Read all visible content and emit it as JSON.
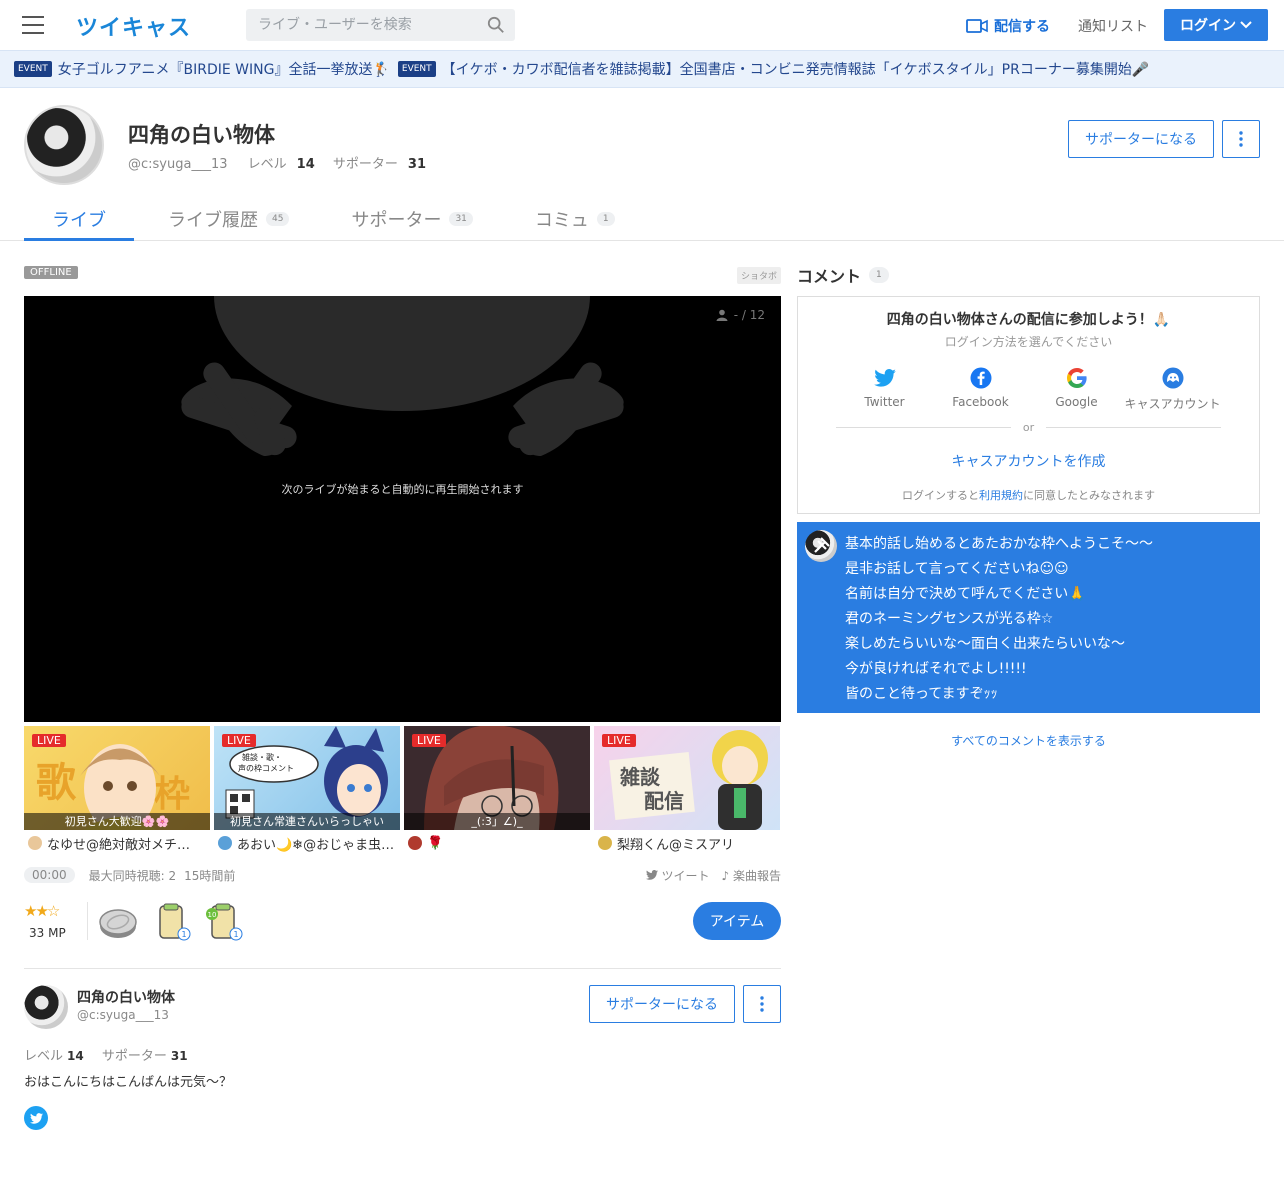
{
  "header": {
    "logo": "ツイキャス",
    "search_placeholder": "ライブ・ユーザーを検索",
    "broadcast_label": "配信する",
    "notify_label": "通知リスト",
    "login_label": "ログイン"
  },
  "events": [
    {
      "badge": "EVENT",
      "text": "女子ゴルフアニメ『BIRDIE WING』全話一挙放送🏌"
    },
    {
      "badge": "EVENT",
      "text": "【イケボ・カワボ配信者を雑誌掲載】全国書店・コンビニ発売情報誌「イケボスタイル」PRコーナー募集開始🎤"
    }
  ],
  "profile": {
    "name": "四角の白い物体",
    "user_id": "@c:syuga___13",
    "level_label": "レベル",
    "level": "14",
    "supporter_label": "サポーター",
    "supporters": "31",
    "support_button": "サポーターになる"
  },
  "tabs": [
    {
      "label": "ライブ",
      "count": ""
    },
    {
      "label": "ライブ履歴",
      "count": "45"
    },
    {
      "label": "サポーター",
      "count": "31"
    },
    {
      "label": "コミュ",
      "count": "1"
    }
  ],
  "player": {
    "status": "OFFLINE",
    "tag": "ショタボ",
    "viewers": "- / 12",
    "message": "次のライブが始まると自動的に再生開始されます"
  },
  "thumbnails": [
    {
      "live": "LIVE",
      "caption": "初見さん大歓迎🌸🌸",
      "owner": "なゆせ@絶対敵対メチ…",
      "bg": "#f4cf63",
      "mini": "#e9c79a"
    },
    {
      "live": "LIVE",
      "caption": "初見さん常連さんいらっしゃい",
      "owner": "あおい🌙❄@おじゃま虫…",
      "bg": "#8fc8ea",
      "mini": "#5aa0d8"
    },
    {
      "live": "LIVE",
      "caption": "_(:3」∠)_",
      "owner": "🌹",
      "bg": "#5a3b3a",
      "mini": "#b03a2e"
    },
    {
      "live": "LIVE",
      "caption": "",
      "owner": "梨翔くん@ミスアリ",
      "bg": "#f2c6e6",
      "mini": "#d9b44a"
    }
  ],
  "stats": {
    "time": "00:00",
    "max_viewers": "最大同時視聴: 2",
    "ago": "15時間前",
    "tweet": "ツイート",
    "music": "楽曲報告"
  },
  "items": {
    "stars": "★★☆",
    "mp": "33 MP",
    "item_count_1": "1",
    "item_count_2": "1",
    "item_button": "アイテム"
  },
  "broadcaster": {
    "name": "四角の白い物体",
    "user_id": "@c:syuga___13",
    "level_label": "レベル",
    "level": "14",
    "supporter_label": "サポーター",
    "supporters": "31",
    "bio": "おはこんにちはこんばんは元気〜？",
    "support_button": "サポーターになる"
  },
  "comments": {
    "title": "コメント",
    "count": "1",
    "login_title": "四角の白い物体さんの配信に参加しよう！🙏🏻",
    "login_sub": "ログイン方法を選んでください",
    "providers": [
      "Twitter",
      "Facebook",
      "Google",
      "キャスアカウント"
    ],
    "or": "or",
    "create": "キャスアカウントを作成",
    "terms_pre": "ログインすると",
    "terms_link": "利用規約",
    "terms_post": "に同意したとみなされます",
    "pinned_lines": [
      "基本的話し始めるとあたおかな枠へようこそ〜〜",
      "是非お話して言ってくださいね☺︎☺︎",
      "名前は自分で決めて呼んでください🙏",
      "君のネーミングセンスが光る枠☆",
      "楽しめたらいいな〜面白く出来たらいいな〜",
      "今が良ければそれでよし!!!!!",
      "皆のこと待ってますぞｯｯ"
    ],
    "all_comments": "すべてのコメントを表示する"
  },
  "colors": {
    "accent": "#2a7de1",
    "live_badge": "#e52b2b",
    "event_badge": "#1b3f86"
  }
}
